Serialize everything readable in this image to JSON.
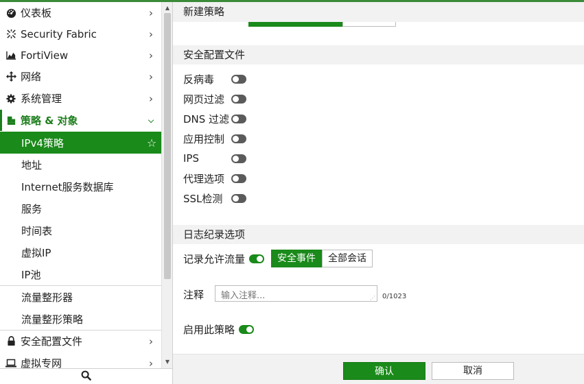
{
  "sidebar": {
    "items": [
      {
        "label": "仪表板",
        "icon": "dashboard-icon"
      },
      {
        "label": "Security Fabric",
        "icon": "security-fabric-icon"
      },
      {
        "label": "FortiView",
        "icon": "fortiview-chart-icon"
      },
      {
        "label": "网络",
        "icon": "network-move-icon"
      },
      {
        "label": "系统管理",
        "icon": "gear-icon"
      },
      {
        "label": "策略 & 对象",
        "icon": "policy-objects-icon"
      },
      {
        "label": "IPv4策略"
      },
      {
        "label": "地址"
      },
      {
        "label": "Internet服务数据库"
      },
      {
        "label": "服务"
      },
      {
        "label": "时间表"
      },
      {
        "label": "虚拟IP"
      },
      {
        "label": "IP池"
      },
      {
        "label": "流量整形器"
      },
      {
        "label": "流量整形策略"
      },
      {
        "label": "安全配置文件",
        "icon": "lock-icon"
      },
      {
        "label": "虚拟专网",
        "icon": "laptop-icon"
      }
    ]
  },
  "main": {
    "title": "新建策略",
    "security_profiles": {
      "header": "安全配置文件",
      "toggles": [
        {
          "label": "反病毒",
          "on": false
        },
        {
          "label": "网页过滤",
          "on": false
        },
        {
          "label": "DNS 过滤",
          "on": false
        },
        {
          "label": "应用控制",
          "on": false
        },
        {
          "label": "IPS",
          "on": false
        },
        {
          "label": "代理选项",
          "on": false
        },
        {
          "label": "SSL检测",
          "on": false
        }
      ]
    },
    "logging": {
      "header": "日志纪录选项",
      "log_allowed_label": "记录允许流量",
      "log_allowed_on": true,
      "options": [
        "安全事件",
        "全部会话"
      ],
      "selected": "安全事件"
    },
    "comment": {
      "label": "注释",
      "placeholder": "输入注释...",
      "counter": "0/1023"
    },
    "enable": {
      "label": "启用此策略",
      "on": true
    }
  },
  "footer": {
    "ok_label": "确认",
    "cancel_label": "取消"
  },
  "colors": {
    "accent": "#1a8a1a",
    "toggle_off": "#5b5b5b",
    "section_bg": "#f2f2f2"
  }
}
